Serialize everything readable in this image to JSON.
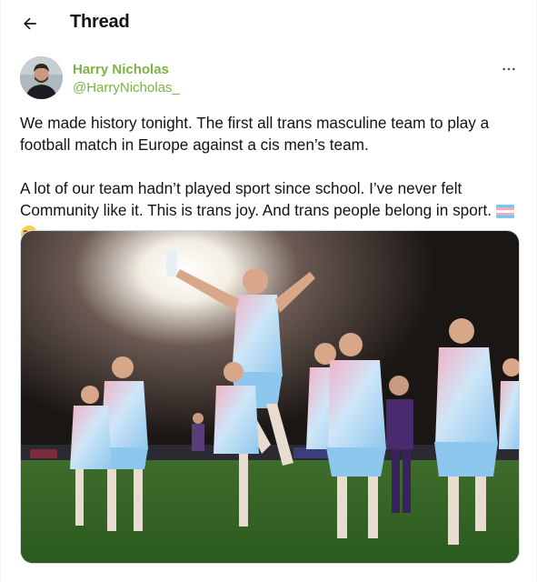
{
  "header": {
    "title": "Thread",
    "back_icon": "arrow-left-icon"
  },
  "author": {
    "name": "Harry Nicholas",
    "handle": "@HarryNicholas_",
    "avatar_icon": "profile-photo",
    "more_icon": "more-horizontal-icon"
  },
  "tweet": {
    "paragraph1": "We made history tonight. The first all trans masculine team to play a football match in Europe against a cis men’s team.",
    "paragraph2": "A lot of our team hadn’t played sport since school. I’ve never felt Community like it. This is trans joy. And trans people belong in sport.",
    "emoji": [
      "transgender-flag-emoji",
      "loudly-crying-face-emoji"
    ]
  },
  "media": {
    "kind": "photo",
    "description_icon": "team-celebration-photo"
  },
  "colors": {
    "name_color": "#7cb342",
    "text_color": "#0f1419",
    "border_color": "#cfd9de",
    "trans_blue": "#5bcefa",
    "trans_pink": "#f5a9b8"
  }
}
